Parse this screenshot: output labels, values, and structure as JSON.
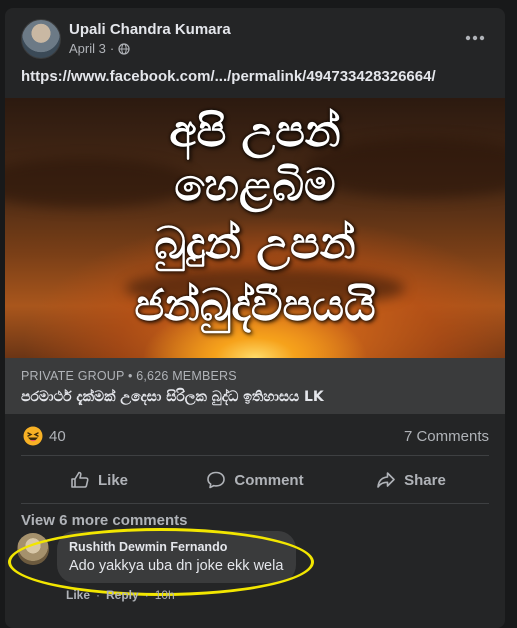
{
  "post": {
    "author": "Upali Chandra Kumara",
    "date": "April 3",
    "visibility_icon": "globe-icon",
    "more_icon": "more-horizontal-icon",
    "text": "https://www.facebook.com/.../permalink/494733428326664/"
  },
  "image": {
    "lines": [
      "අපි උපන්",
      "හෙළබිම",
      "බුදුන් උපන්",
      "ජන්බුද්වීපයයි"
    ]
  },
  "share": {
    "subtitle": "PRIVATE GROUP • 6,626 MEMBERS",
    "title": "පරමාර්ථ දැක්මක් උදෙසා සිරිලක බුද්ධ ඉතිහාසය LK"
  },
  "stats": {
    "reaction_icon": "haha-reaction-icon",
    "reaction_count": "40",
    "comments": "7 Comments"
  },
  "actions": {
    "like": "Like",
    "comment": "Comment",
    "share": "Share"
  },
  "comments": {
    "view_more": "View 6 more comments",
    "items": [
      {
        "author": "Rushith Dewmin Fernando",
        "text": "Ado yakkya uba dn joke ekk wela",
        "like": "Like",
        "reply": "Reply",
        "time": "10h"
      }
    ]
  },
  "colors": {
    "background": "#18191a",
    "card": "#242526",
    "highlight": "#f2e600"
  }
}
